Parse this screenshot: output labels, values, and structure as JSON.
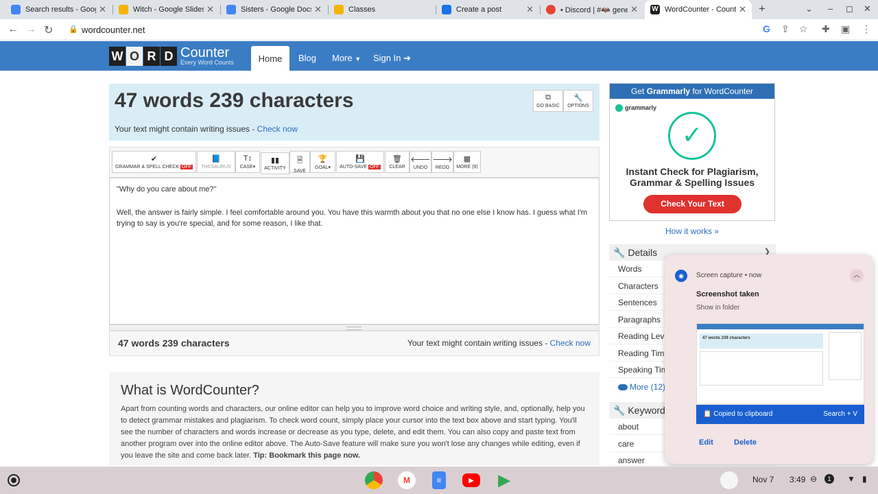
{
  "browser": {
    "tabs": [
      {
        "title": "Search results - Google",
        "color": "#4285f4"
      },
      {
        "title": "Witch - Google Slides",
        "color": "#f4b400"
      },
      {
        "title": "Sisters - Google Docs",
        "color": "#4285f4"
      },
      {
        "title": "Classes",
        "color": "#f4b400"
      },
      {
        "title": "Create a post",
        "color": "#1a73e8"
      },
      {
        "title": "• Discord | #🦇 gene",
        "color": "#ea4335"
      },
      {
        "title": "WordCounter - Count",
        "color": "#1f1f1f"
      }
    ],
    "url": "wordcounter.net"
  },
  "site": {
    "logo_letters": [
      "W",
      "O",
      "R",
      "D"
    ],
    "logo_counter": "Counter",
    "logo_tagline": "Every Word Counts",
    "nav": {
      "home": "Home",
      "blog": "Blog",
      "more": "More",
      "signin": "Sign In"
    }
  },
  "counter": {
    "title": "47 words 239 characters",
    "issues_text": "Your text might contain writing issues - ",
    "check_now": "Check now",
    "go_basic": "GO BASIC",
    "options": "OPTIONS"
  },
  "toolbar": {
    "grammar": "GRAMMAR & SPELL CHECK",
    "off": "OFF",
    "thesaurus": "THESAURUS",
    "case": "CASE",
    "activity": "ACTIVITY",
    "save": "SAVE",
    "goal": "GOAL",
    "autosave": "AUTO-SAVE",
    "clear": "CLEAR",
    "undo": "UNDO",
    "redo": "REDO",
    "more": "MORE (9)"
  },
  "editor": {
    "para1": "\"Why do you care about me?\"",
    "para2": "Well, the answer is fairly simple.  I feel comfortable around you.  You have this warmth about you that no one else I know has.  I guess what I'm trying to say is you're special, and for some reason, I like that."
  },
  "whatis": {
    "heading": "What is WordCounter?",
    "body": "Apart from counting words and characters, our online editor can help you to improve word choice and writing style, and, optionally, help you to detect grammar mistakes and plagiarism. To check word count, simply place your cursor into the text box above and start typing. You'll see the number of characters and words increase or decrease as you type, delete, and edit them. You can also copy and paste text from another program over into the online editor above. The Auto-Save feature will make sure you won't lose any changes while editing, even if you leave the site and come back later. ",
    "tip": "Tip: Bookmark this page now."
  },
  "ad": {
    "header_pre": "Get ",
    "header_brand": "Grammarly",
    "header_post": " for WordCounter",
    "brand": "grammarly",
    "line1": "Instant Check for Plagiarism,",
    "line2": "Grammar & Spelling Issues",
    "button": "Check Your Text",
    "how": "How it works »"
  },
  "details": {
    "title": "Details",
    "rows": [
      "Words",
      "Characters",
      "Sentences",
      "Paragraphs",
      "Reading Leve",
      "Reading Time",
      "Speaking Tim"
    ],
    "more": "More (12)"
  },
  "keywords": {
    "title": "Keyword D",
    "rows": [
      "about",
      "care",
      "answer"
    ]
  },
  "notification": {
    "source": "Screen capture",
    "time": "now",
    "title": "Screenshot taken",
    "subtitle": "Show in folder",
    "thumb_title": "47 words 239 characters",
    "copied": "Copied to clipboard",
    "search": "Search + V",
    "edit": "Edit",
    "delete": "Delete"
  },
  "shelf": {
    "date": "Nov 7",
    "time": "3:49",
    "badge": "1"
  }
}
